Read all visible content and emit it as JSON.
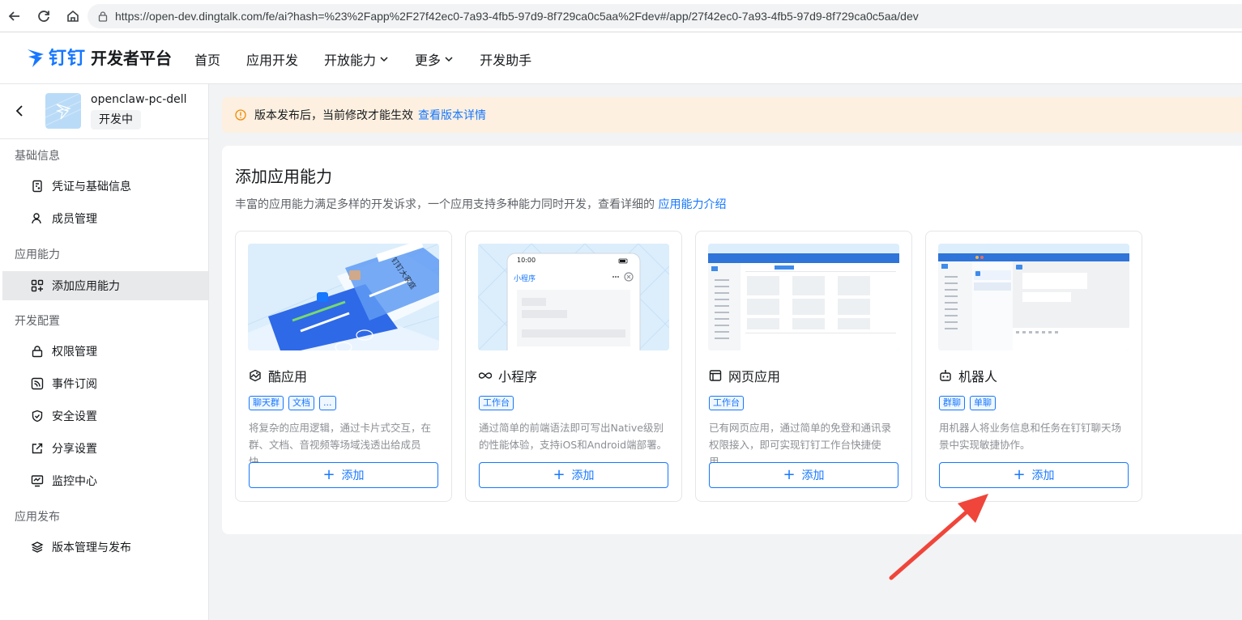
{
  "browser": {
    "url": "https://open-dev.dingtalk.com/fe/ai?hash=%23%2Fapp%2F27f42ec0-7a93-4fb5-97d9-8f729ca0c5aa%2Fdev#/app/27f42ec0-7a93-4fb5-97d9-8f729ca0c5aa/dev"
  },
  "header": {
    "logo_text": "钉钉",
    "platform_title": "开发者平台",
    "nav": [
      "首页",
      "应用开发",
      "开放能力",
      "更多",
      "开发助手"
    ]
  },
  "sidebar": {
    "app_name": "openclaw-pc-dell",
    "app_status": "开发中",
    "groups": {
      "basic": "基础信息",
      "capability": "应用能力",
      "dev_config": "开发配置",
      "release": "应用发布"
    },
    "items": {
      "credentials": "凭证与基础信息",
      "members": "成员管理",
      "add_capability": "添加应用能力",
      "permissions": "权限管理",
      "events": "事件订阅",
      "security": "安全设置",
      "share": "分享设置",
      "monitor": "监控中心",
      "versions": "版本管理与发布"
    }
  },
  "notice": {
    "text": "版本发布后，当前修改才能生效",
    "link": "查看版本详情"
  },
  "main": {
    "title": "添加应用能力",
    "desc": "丰富的应用能力满足多样的开发诉求，一个应用支持多种能力同时开发，查看详细的",
    "desc_link": "应用能力介绍",
    "cards": [
      {
        "title": "酷应用",
        "icon": "cool-app-icon",
        "tags": [
          "聊天群",
          "文档",
          "..."
        ],
        "desc": "将复杂的应用逻辑，通过卡片式交互，在群、文档、音视频等场域浅透出给成员快...",
        "button": "添加"
      },
      {
        "title": "小程序",
        "icon": "miniprogram-icon",
        "tags": [
          "工作台"
        ],
        "desc": "通过简单的前端语法即可写出Native级别的性能体验，支持iOS和Android端部署。",
        "button": "添加"
      },
      {
        "title": "网页应用",
        "icon": "web-app-icon",
        "tags": [
          "工作台"
        ],
        "desc": "已有网页应用，通过简单的免登和通讯录权限接入，即可实现钉钉工作台快捷使用。",
        "button": "添加"
      },
      {
        "title": "机器人",
        "icon": "robot-icon",
        "tags": [
          "群聊",
          "单聊"
        ],
        "desc": "用机器人将业务信息和任务在钉钉聊天场景中实现敏捷协作。",
        "button": "添加"
      }
    ],
    "preview_texts": {
      "cool_app_banner": "钉钉大家庭",
      "phone_time": "10:00",
      "phone_title": "小程序"
    }
  },
  "colors": {
    "accent": "#1677ff",
    "notice_bg": "#fdf0e0",
    "annotation_arrow": "#f0453a"
  }
}
